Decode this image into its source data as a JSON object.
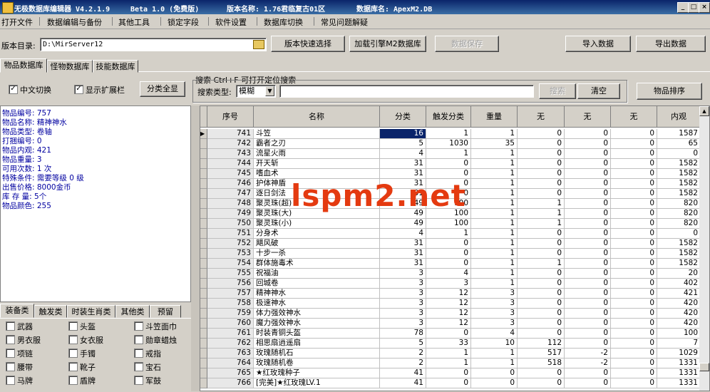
{
  "titlebar": {
    "app_title": "无极数据库编辑器 V4.2.1.9",
    "edition": "Beta 1.0 (免费版)",
    "version_name": "版本名称: 1.76君临复古01区",
    "db_name": "数据库名: ApexM2.DB"
  },
  "menu": [
    "打开文件",
    "数据编辑与备份",
    "其他工具",
    "锁定字段",
    "软件设置",
    "数据库切换",
    "常见问题解疑"
  ],
  "toolbar": {
    "dir_label": "版本目录:",
    "dir_value": "D:\\MirServer12",
    "quick_select": "版本快速选择",
    "load_engine": "加载引擎M2数据库",
    "save_data": "数据保存",
    "import": "导入数据",
    "export": "导出数据"
  },
  "db_tabs": [
    "物品数据库",
    "怪物数据库",
    "技能数据库"
  ],
  "options": {
    "chinese_toggle": "中文切换",
    "show_ext": "显示扩展栏",
    "show_all": "分类全显"
  },
  "search": {
    "title": "搜索  Ctrl+F 可打开定位搜索",
    "type_label": "搜索类型:",
    "type_value": "模糊",
    "search_btn": "搜索",
    "clear_btn": "清空",
    "sort_btn": "物品排序"
  },
  "info": [
    "物品编号: 757",
    "物品名称: 精神神水",
    "物品类型: 卷轴",
    "打捆编号: 0",
    "物品内观: 421",
    "物品重量: 3",
    "可用次数: 1 次",
    "特殊条件: 需要等级 0 级",
    "出售价格: 8000金币",
    "库 存 量: 5个",
    "物品颜色: 255"
  ],
  "category_tabs": [
    "装备类",
    "触发类",
    "时装生肖类",
    "其他类",
    "预留"
  ],
  "categories": [
    [
      "武器",
      "头盔",
      "斗笠面巾"
    ],
    [
      "男衣服",
      "女衣服",
      "勋章蜡烛"
    ],
    [
      "项链",
      "手镯",
      "戒指"
    ],
    [
      "腰带",
      "靴子",
      "宝石"
    ],
    [
      "马牌",
      "盾牌",
      "军鼓"
    ]
  ],
  "grid": {
    "headers": [
      "序号",
      "名称",
      "分类",
      "触发分类",
      "重量",
      "无",
      "无",
      "无",
      "内观"
    ],
    "rows": [
      [
        "741",
        "斗笠",
        "16",
        "1",
        "1",
        "0",
        "0",
        "0",
        "1587"
      ],
      [
        "742",
        "霸者之刃",
        "5",
        "1030",
        "35",
        "0",
        "0",
        "0",
        "65"
      ],
      [
        "743",
        "流星火雨",
        "4",
        "1",
        "1",
        "0",
        "0",
        "0",
        "0"
      ],
      [
        "744",
        "开天斩",
        "31",
        "0",
        "1",
        "0",
        "0",
        "0",
        "1582"
      ],
      [
        "745",
        "嗜血术",
        "31",
        "0",
        "1",
        "0",
        "0",
        "0",
        "1582"
      ],
      [
        "746",
        "护体神盾",
        "31",
        "0",
        "1",
        "0",
        "0",
        "0",
        "1582"
      ],
      [
        "747",
        "逐日剑法",
        "31",
        "0",
        "1",
        "0",
        "0",
        "0",
        "1582"
      ],
      [
        "748",
        "聚灵珠(超)",
        "49",
        "100",
        "1",
        "1",
        "0",
        "0",
        "820"
      ],
      [
        "749",
        "聚灵珠(大)",
        "49",
        "100",
        "1",
        "1",
        "0",
        "0",
        "820"
      ],
      [
        "750",
        "聚灵珠(小)",
        "49",
        "100",
        "1",
        "1",
        "0",
        "0",
        "820"
      ],
      [
        "751",
        "分身术",
        "4",
        "1",
        "1",
        "0",
        "0",
        "0",
        "0"
      ],
      [
        "752",
        "飓风破",
        "31",
        "0",
        "1",
        "0",
        "0",
        "0",
        "1582"
      ],
      [
        "753",
        "十步一杀",
        "31",
        "0",
        "1",
        "0",
        "0",
        "0",
        "1582"
      ],
      [
        "754",
        "群体施毒术",
        "31",
        "0",
        "1",
        "1",
        "0",
        "0",
        "1582"
      ],
      [
        "755",
        "祝福油",
        "3",
        "4",
        "1",
        "0",
        "0",
        "0",
        "20"
      ],
      [
        "756",
        "回城卷",
        "3",
        "3",
        "1",
        "0",
        "0",
        "0",
        "402"
      ],
      [
        "757",
        "精神神水",
        "3",
        "12",
        "3",
        "0",
        "0",
        "0",
        "421"
      ],
      [
        "758",
        "极速神水",
        "3",
        "12",
        "3",
        "0",
        "0",
        "0",
        "420"
      ],
      [
        "759",
        "体力强效神水",
        "3",
        "12",
        "3",
        "0",
        "0",
        "0",
        "420"
      ],
      [
        "760",
        "魔力强效神水",
        "3",
        "12",
        "3",
        "0",
        "0",
        "0",
        "420"
      ],
      [
        "761",
        "时装青铜头盔",
        "78",
        "0",
        "4",
        "0",
        "0",
        "0",
        "100"
      ],
      [
        "762",
        "相思扇逍遥扇",
        "5",
        "33",
        "10",
        "112",
        "0",
        "0",
        "7"
      ],
      [
        "763",
        "玫瑰随机石",
        "2",
        "1",
        "1",
        "517",
        "-2",
        "0",
        "1029"
      ],
      [
        "764",
        "玫瑰随机卷",
        "2",
        "1",
        "1",
        "518",
        "-2",
        "0",
        "1331"
      ],
      [
        "765",
        "★红玫瑰种子",
        "41",
        "0",
        "0",
        "0",
        "0",
        "0",
        "1331"
      ],
      [
        "766",
        "[完美]★红玫瑰LV.1",
        "41",
        "0",
        "0",
        "0",
        "0",
        "0",
        "1331"
      ]
    ]
  },
  "watermark": "lspm2.net"
}
